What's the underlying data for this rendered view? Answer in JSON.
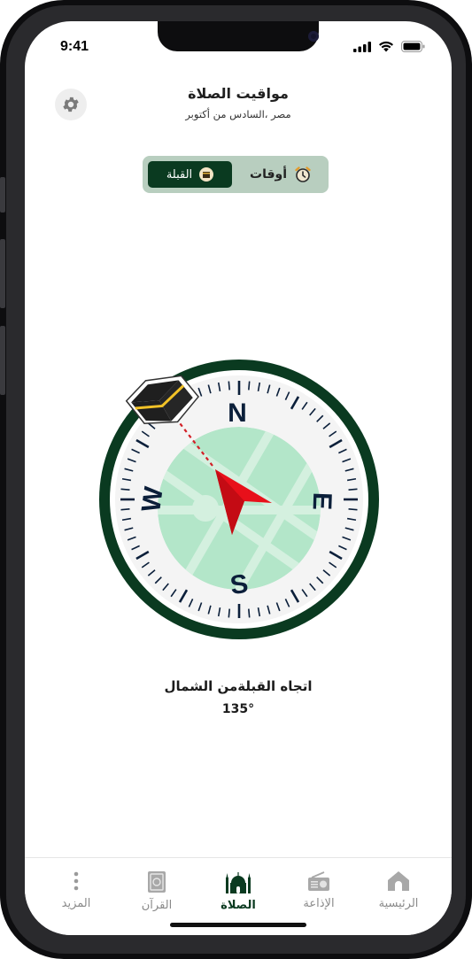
{
  "status_bar": {
    "time": "9:41"
  },
  "header": {
    "title": "مواقيت الصلاة",
    "subtitle": "مصر ،السادس من أكتوبر"
  },
  "toggle": {
    "qibla_label": "القبلة",
    "times_label": "أوقات"
  },
  "compass": {
    "north": "N",
    "south": "S",
    "east": "E",
    "west": "W",
    "qibla_heading_deg": 135,
    "colors": {
      "ring": "#0a3a20",
      "map": "#b3e6c9",
      "needle": "#e8101a"
    }
  },
  "qibla": {
    "direction_text": "اتجاه القبلةمن الشمال",
    "degree_text": "135°"
  },
  "tabs": [
    {
      "label": "المزيد",
      "icon": "more-icon"
    },
    {
      "label": "القرآن",
      "icon": "quran-icon"
    },
    {
      "label": "الصلاة",
      "icon": "mosque-icon",
      "active": true
    },
    {
      "label": "الإذاعة",
      "icon": "radio-icon"
    },
    {
      "label": "الرئيسية",
      "icon": "home-icon"
    }
  ]
}
